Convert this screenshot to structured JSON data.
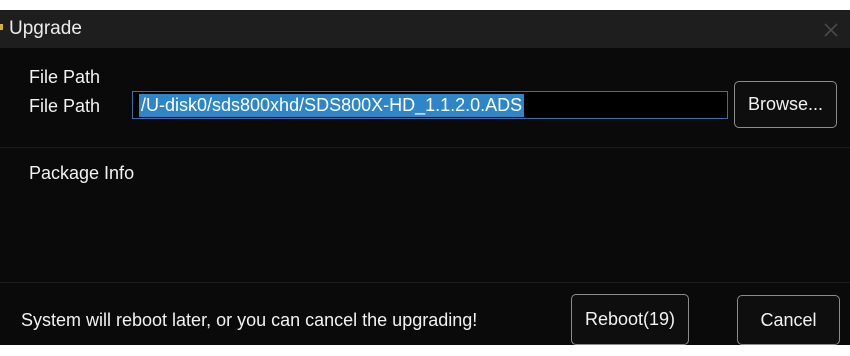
{
  "dialog": {
    "title": "Upgrade",
    "close_icon": "close-icon"
  },
  "file_path": {
    "group_label": "File Path",
    "field_label": "File Path",
    "value": "/U-disk0/sds800xhd/SDS800X-HD_1.1.2.0.ADS",
    "browse_label": "Browse..."
  },
  "package_info": {
    "label": "Package Info"
  },
  "footer": {
    "status_text": "System will reboot later, or you can cancel the upgrading!",
    "reboot_label": "Reboot(19)",
    "cancel_label": "Cancel"
  },
  "colors": {
    "titlebar": "#1e1e1e",
    "body": "#0a0a0a",
    "selection": "#2e86c9",
    "button_border": "#8c8c8c"
  }
}
